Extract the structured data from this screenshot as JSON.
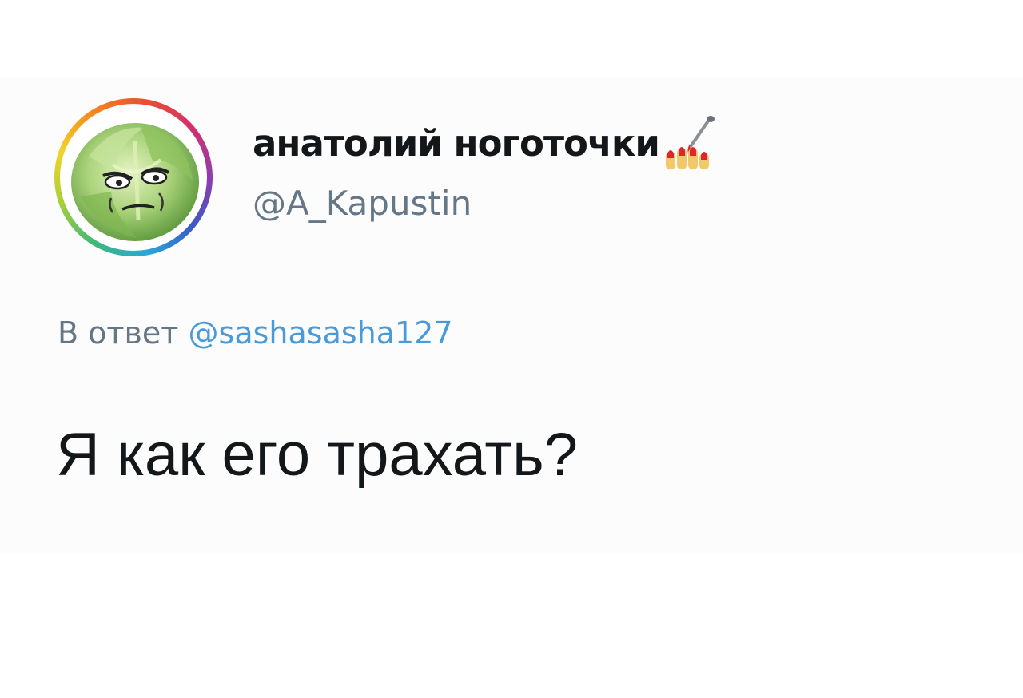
{
  "tweet": {
    "display_name": "анатолий ноготочки",
    "name_emoji": "nail-polish-icon",
    "handle": "@A_Kapustin",
    "reply_prefix": "В ответ",
    "reply_to": "@sashasasha127",
    "text": "Я как его трахать?",
    "avatar": "cabbage-avatar-icon"
  },
  "colors": {
    "name": "#14171a",
    "handle": "#657786",
    "mention": "#4a99d8",
    "background": "#fcfcfc"
  }
}
